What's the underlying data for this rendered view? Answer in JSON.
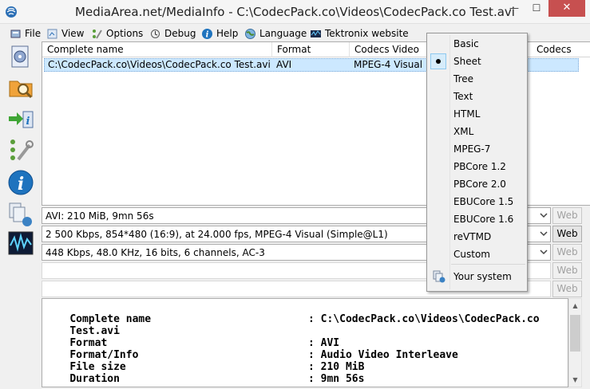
{
  "window": {
    "title": "MediaArea.net/MediaInfo - C:\\CodecPack.co\\Videos\\CodecPack.co Test.avi",
    "minimize": "—",
    "maximize": "☐",
    "close": "✕"
  },
  "menu": {
    "file": "File",
    "view": "View",
    "options": "Options",
    "debug": "Debug",
    "help": "Help",
    "language": "Language",
    "tektronix": "Tektronix website"
  },
  "list": {
    "columns": [
      "Complete name",
      "Format",
      "Codecs Video",
      "Codecs"
    ],
    "row": {
      "complete_name": "C:\\CodecPack.co\\Videos\\CodecPack.co Test.avi",
      "format": "AVI",
      "codecs_video": "MPEG-4 Visual"
    }
  },
  "streams": [
    {
      "text": "AVI: 210 MiB, 9mn 56s",
      "web": "Web",
      "web_enabled": false
    },
    {
      "text": "2 500 Kbps, 854*480 (16:9), at 24.000 fps, MPEG-4 Visual (Simple@L1)",
      "web": "Web",
      "web_enabled": true
    },
    {
      "text": "448 Kbps, 48.0 KHz, 16 bits, 6 channels, AC-3",
      "web": "Web",
      "web_enabled": false
    },
    {
      "text": "",
      "web": "Web",
      "web_enabled": false
    },
    {
      "text": "",
      "web": "Web",
      "web_enabled": false
    }
  ],
  "details": [
    {
      "label": "Complete name",
      "value": ": C:\\CodecPack.co\\Videos\\CodecPack.co"
    },
    {
      "label": "Test.avi",
      "value": ""
    },
    {
      "label": "Format",
      "value": ": AVI"
    },
    {
      "label": "Format/Info",
      "value": ": Audio Video Interleave"
    },
    {
      "label": "File size",
      "value": ": 210 MiB"
    },
    {
      "label": "Duration",
      "value": ": 9mn 56s"
    }
  ],
  "view_menu": {
    "items": [
      "Basic",
      "Sheet",
      "Tree",
      "Text",
      "HTML",
      "XML",
      "MPEG-7",
      "PBCore 1.2",
      "PBCore 2.0",
      "EBUCore 1.5",
      "EBUCore 1.6",
      "reVTMD",
      "Custom"
    ],
    "selected": "Sheet",
    "your_system": "Your system"
  },
  "colors": {
    "selection": "#cce8ff",
    "close_button": "#c75050",
    "accent_blue": "#1e73be"
  }
}
